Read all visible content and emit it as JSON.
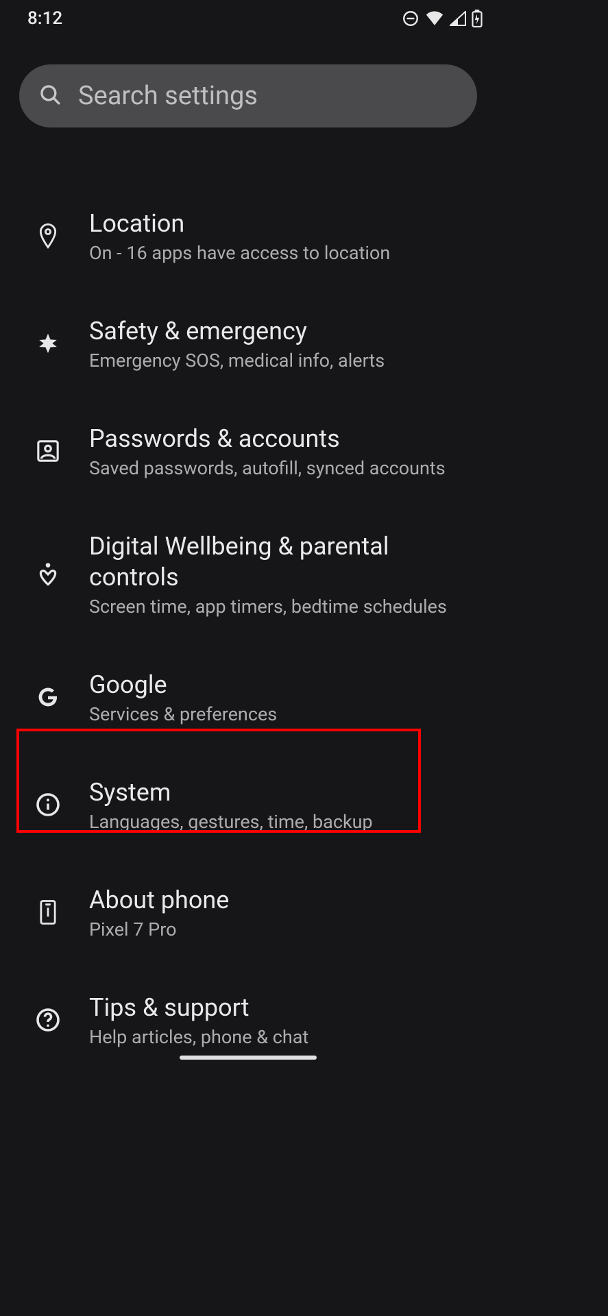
{
  "status": {
    "time": "8:12"
  },
  "search": {
    "placeholder": "Search settings"
  },
  "items": {
    "location": {
      "title": "Location",
      "sub": "On - 16 apps have access to location"
    },
    "safety": {
      "title": "Safety & emergency",
      "sub": "Emergency SOS, medical info, alerts"
    },
    "passwords": {
      "title": "Passwords & accounts",
      "sub": "Saved passwords, autofill, synced accounts"
    },
    "wellbeing": {
      "title": "Digital Wellbeing & parental controls",
      "sub": "Screen time, app timers, bedtime schedules"
    },
    "google": {
      "title": "Google",
      "sub": "Services & preferences"
    },
    "system": {
      "title": "System",
      "sub": "Languages, gestures, time, backup"
    },
    "about": {
      "title": "About phone",
      "sub": "Pixel 7 Pro"
    },
    "tips": {
      "title": "Tips & support",
      "sub": "Help articles, phone & chat"
    }
  },
  "highlight": {
    "target": "system"
  }
}
